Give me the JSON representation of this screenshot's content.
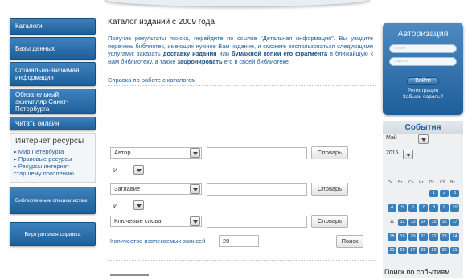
{
  "sidebar": {
    "nav": [
      "Каталоги",
      "Базы данных",
      "Социально-значимая информация",
      "Обязательный экземпляр Санкт-Петербурга",
      "Читать онлайн"
    ],
    "resources_title": "Интернет ресурсы",
    "resources": [
      "Мир Петербурга",
      "Правовые ресурсы",
      "Ресурсы интернет – старшему поколению"
    ],
    "specialists": "Библиотечным специалистам",
    "virtual_help": "Виртуальная справка"
  },
  "main": {
    "title": "Каталог изданий с 2009 года",
    "intro_1": "Получив результаты поиска, перейдите по ссылке \"Детальная информация\". Вы увидите перечень библиотек, имеющих нужное Вам издание, и сможете воспользоваться следующими услугами: заказать ",
    "intro_b1": "доставку издания",
    "intro_2": " или ",
    "intro_b2": "бумажной копии его фрагмента",
    "intro_3": " в ближайшую к Вам библиотеку, а также ",
    "intro_b3": "забронировать",
    "intro_4": " его в своей библиотеке.",
    "help_link": "Справка по работе с каталогом",
    "search": {
      "field1": "Автор",
      "field2": "Заглавие",
      "field3": "Ключевые слова",
      "op1": "И",
      "op2": "И",
      "dict_label": "Словарь",
      "count_label": "Количество извлекаемых записей",
      "count_value": "20",
      "search_label": "Поиск"
    }
  },
  "auth": {
    "title": "Авторизация",
    "login_placeholder": "логин",
    "password_placeholder": "пароль",
    "login_btn": "Войти",
    "register": "Регистрация",
    "forgot": "Забыли пароль?"
  },
  "events": {
    "title": "События",
    "month": "Май",
    "year": "2015",
    "weekdays": [
      "Пн",
      "Вт",
      "Ср",
      "Чт",
      "Пт",
      "Сб",
      "Вс"
    ],
    "days": [
      "1",
      "2",
      "3",
      "4",
      "5",
      "6",
      "7",
      "8",
      "9",
      "10",
      "11",
      "12",
      "13",
      "14",
      "15",
      "16",
      "17",
      "18",
      "19",
      "20",
      "21",
      "22",
      "23",
      "24",
      "25",
      "26",
      "27",
      "28",
      "29",
      "30",
      "31"
    ],
    "search_title": "Поиск по событиям"
  }
}
